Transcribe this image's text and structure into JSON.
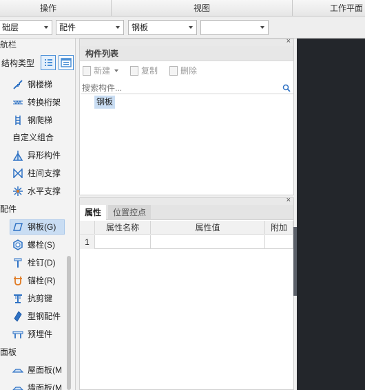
{
  "menu": {
    "items": [
      "操作",
      "视图",
      "工作平面"
    ]
  },
  "toolbar": {
    "combos": [
      "础层",
      "配件",
      "钢板",
      ""
    ]
  },
  "leftnav": {
    "title": "航栏",
    "struct_label": "结构类型",
    "items_top": [
      {
        "label": "钢楼梯",
        "icon": "steel-stair-icon"
      },
      {
        "label": "转换桁架",
        "icon": "transfer-truss-icon"
      },
      {
        "label": "钢爬梯",
        "icon": "steel-ladder-icon"
      }
    ],
    "custom_group": "自定义组合",
    "items_custom": [
      {
        "label": "异形构件",
        "icon": "special-member-icon"
      },
      {
        "label": "柱间支撑",
        "icon": "column-brace-icon"
      },
      {
        "label": "水平支撑",
        "icon": "horizontal-brace-icon"
      }
    ],
    "fittings_group": "配件",
    "items_fittings": [
      {
        "label": "钢板(G)",
        "icon": "steel-plate-icon"
      },
      {
        "label": "螺栓(S)",
        "icon": "bolt-icon"
      },
      {
        "label": "栓钉(D)",
        "icon": "stud-icon"
      },
      {
        "label": "锚栓(R)",
        "icon": "anchor-bolt-icon"
      },
      {
        "label": "抗剪键",
        "icon": "shear-key-icon"
      },
      {
        "label": "型钢配件",
        "icon": "section-steel-fitting-icon"
      },
      {
        "label": "预埋件",
        "icon": "embedded-part-icon"
      }
    ],
    "panel_group": "面板",
    "items_panel": [
      {
        "label": "屋面板(M",
        "icon": "roof-panel-icon"
      },
      {
        "label": "墙面板(M",
        "icon": "wall-panel-icon"
      }
    ]
  },
  "component_list": {
    "title": "构件列表",
    "new_label": "新建",
    "copy_label": "复制",
    "delete_label": "删除",
    "search_placeholder": "搜索构件...",
    "items": [
      "钢板"
    ]
  },
  "properties": {
    "tab_props": "属性",
    "tab_points": "位置控点",
    "col_name": "属性名称",
    "col_value": "属性值",
    "col_extra": "附加",
    "rows": [
      {
        "index": "1",
        "name": "",
        "value": "",
        "extra": ""
      }
    ]
  },
  "colors": {
    "selection": "#c9ddf3",
    "accent": "#4a8fd6",
    "canvas": "#23262b"
  }
}
